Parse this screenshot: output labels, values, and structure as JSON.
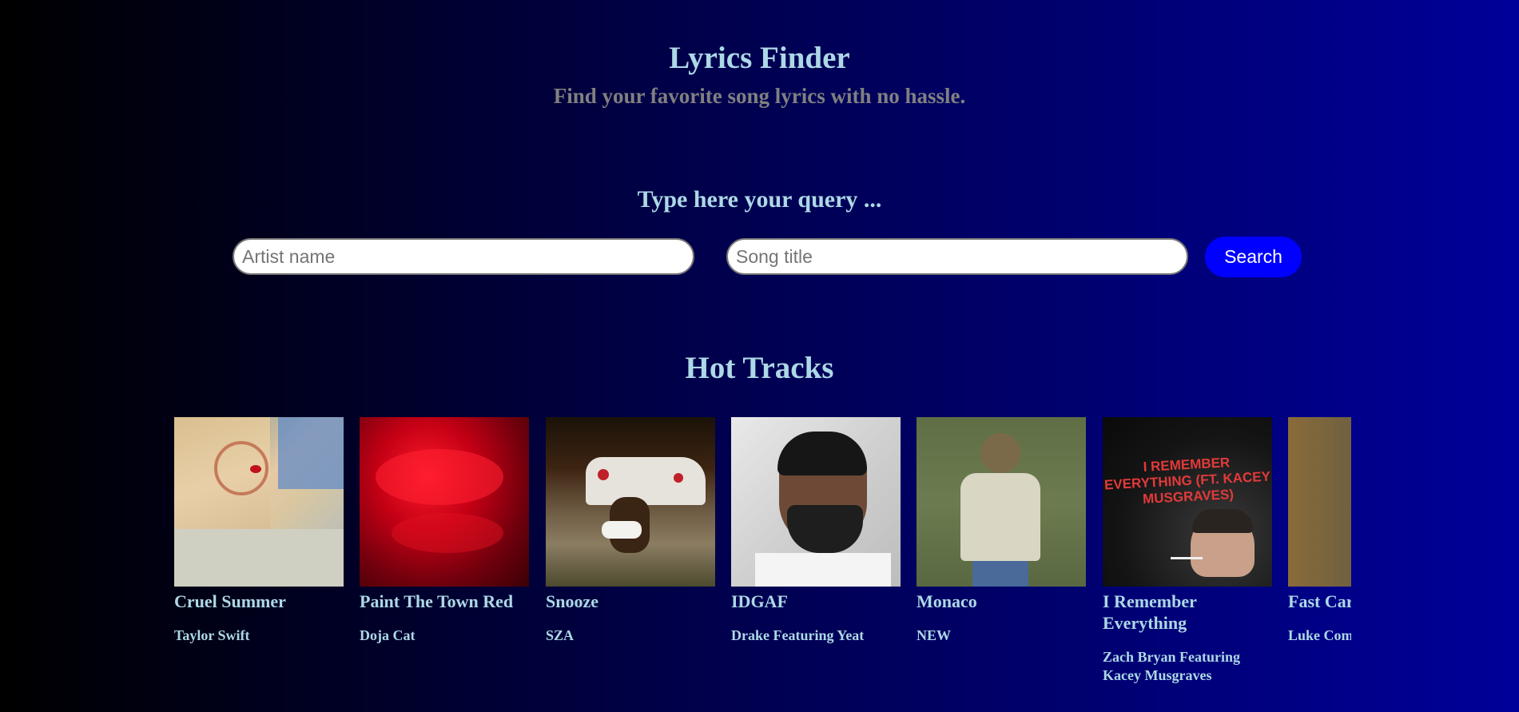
{
  "header": {
    "title": "Lyrics Finder",
    "subtitle": "Find your favorite song lyrics with no hassle."
  },
  "search": {
    "label": "Type here your query ...",
    "artist_placeholder": "Artist name",
    "artist_value": "",
    "song_placeholder": "Song title",
    "song_value": "",
    "button_label": "Search"
  },
  "hot_tracks": {
    "heading": "Hot Tracks",
    "items": [
      {
        "title": "Cruel Summer",
        "artist": "Taylor Swift",
        "cover": "album-cover"
      },
      {
        "title": "Paint The Town Red",
        "artist": "Doja Cat",
        "cover": "album-cover"
      },
      {
        "title": "Snooze",
        "artist": "SZA",
        "cover": "album-cover"
      },
      {
        "title": "IDGAF",
        "artist": "Drake Featuring Yeat",
        "cover": "album-cover"
      },
      {
        "title": "Monaco",
        "artist": "NEW",
        "cover": "album-cover"
      },
      {
        "title": "I Remember Everything",
        "artist": "Zach Bryan Featuring Kacey Musgraves",
        "cover": "album-cover",
        "cover_text": "I REMEMBER EVERYTHING (FT. KACEY MUSGRAVES)"
      },
      {
        "title": "Fast Car",
        "artist": "Luke Combs",
        "cover": "album-cover"
      }
    ]
  },
  "colors": {
    "heading": "#add8e6",
    "subtitle": "#808080",
    "button": "#0000ff",
    "background_start": "#000000",
    "background_end": "#000099"
  }
}
